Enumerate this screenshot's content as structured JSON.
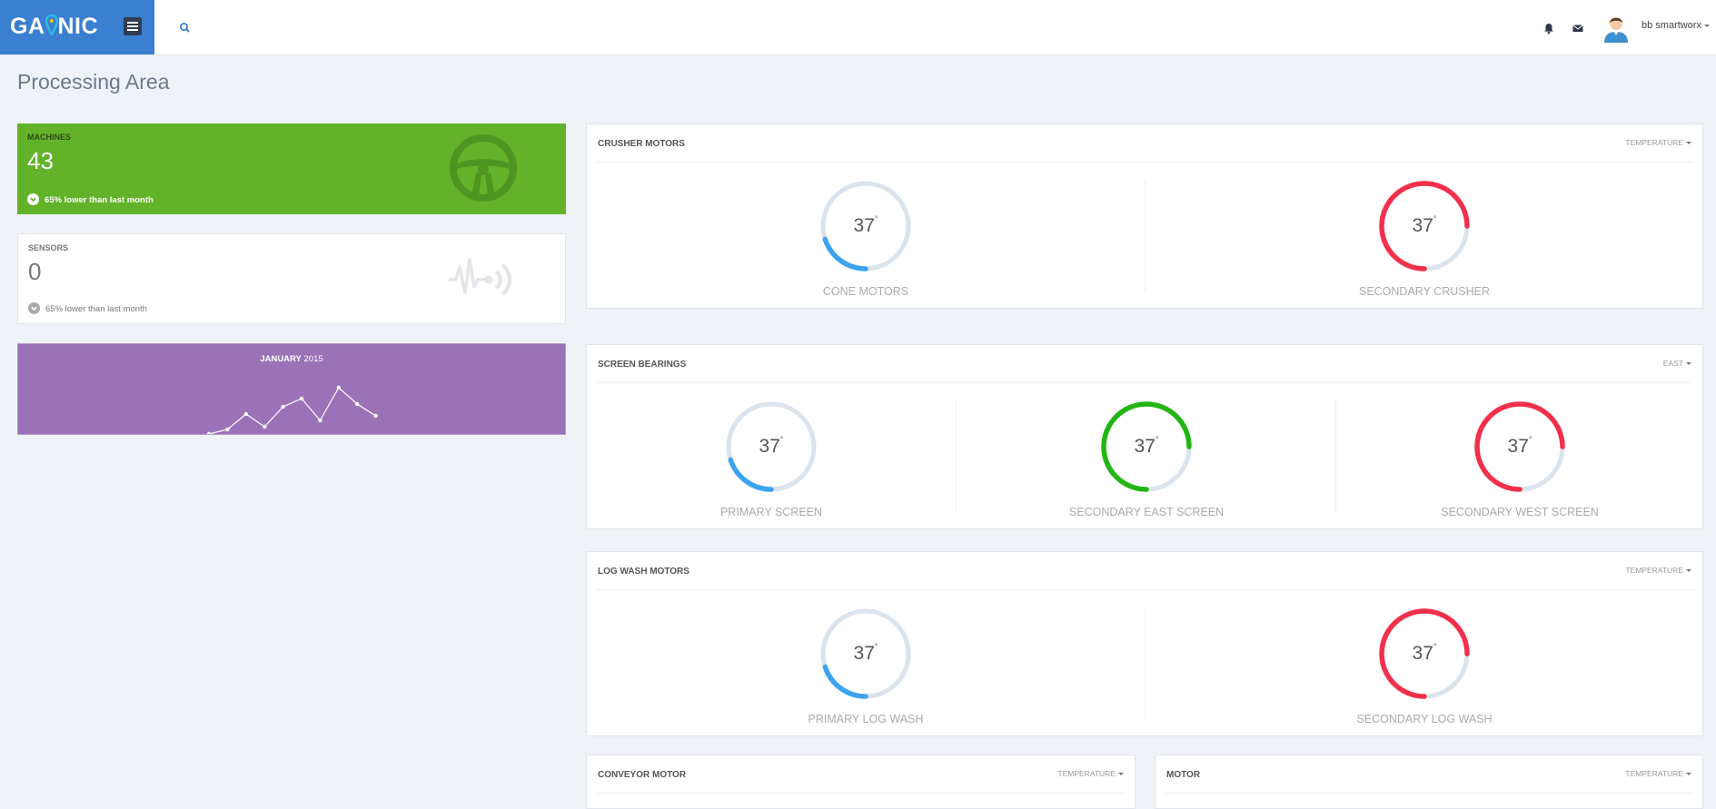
{
  "app": {
    "logo_left": "GA",
    "logo_right": "NIC",
    "logo_pin_color": "#2fb9e6"
  },
  "header": {
    "user_name": "bb smartworx",
    "icons": [
      "menu-icon",
      "search-icon",
      "bell-icon",
      "envelope-icon",
      "user-avatar"
    ]
  },
  "page": {
    "title": "Processing Area"
  },
  "stats": {
    "machines": {
      "title": "MACHINES",
      "value": "43",
      "note": "65% lower than last month",
      "icon": "steering-wheel-icon"
    },
    "sensors": {
      "title": "SENSORS",
      "value": "0",
      "note": "65% lower than last month",
      "icon": "wireless-sensor-icon"
    }
  },
  "trend": {
    "month": "JANUARY",
    "year": "2015",
    "chart_data": {
      "type": "line",
      "values": [
        0,
        5,
        22,
        8,
        30,
        39,
        15,
        51,
        33,
        20
      ]
    }
  },
  "colors": {
    "blue": "#3ca3ef",
    "red": "#f2304b",
    "green": "#22b514",
    "track": "#dbe3ec",
    "machines": "#63b32a",
    "trend": "#9b72b7"
  },
  "panels": {
    "crusher": {
      "title": "CRUSHER MOTORS",
      "filter": "TEMPERATURE",
      "gauges": [
        {
          "value": "37",
          "unit": "°",
          "label": "CONE MOTORS",
          "fraction": 0.2,
          "color": "#3ca3ef"
        },
        {
          "value": "37",
          "unit": "°",
          "label": "SECONDARY CRUSHER",
          "fraction": 0.75,
          "color": "#f2304b"
        }
      ]
    },
    "screen": {
      "title": "SCREEN BEARINGS",
      "filter": "EAST",
      "gauges": [
        {
          "value": "37",
          "unit": "°",
          "label": "PRIMARY SCREEN",
          "fraction": 0.2,
          "color": "#3ca3ef"
        },
        {
          "value": "37",
          "unit": "°",
          "label": "SECONDARY EAST SCREEN",
          "fraction": 0.75,
          "color": "#22b514"
        },
        {
          "value": "37",
          "unit": "°",
          "label": "SECONDARY WEST SCREEN",
          "fraction": 0.75,
          "color": "#f2304b"
        }
      ]
    },
    "logwash": {
      "title": "LOG WASH MOTORS",
      "filter": "TEMPERATURE",
      "gauges": [
        {
          "value": "37",
          "unit": "°",
          "label": "PRIMARY LOG WASH",
          "fraction": 0.2,
          "color": "#3ca3ef"
        },
        {
          "value": "37",
          "unit": "°",
          "label": "SECONDARY LOG WASH",
          "fraction": 0.75,
          "color": "#f2304b"
        }
      ]
    },
    "conveyor": {
      "title": "CONVEYOR MOTOR",
      "filter": "TEMPERATURE"
    },
    "motor": {
      "title": "MOTOR",
      "filter": "TEMPERATURE"
    }
  }
}
